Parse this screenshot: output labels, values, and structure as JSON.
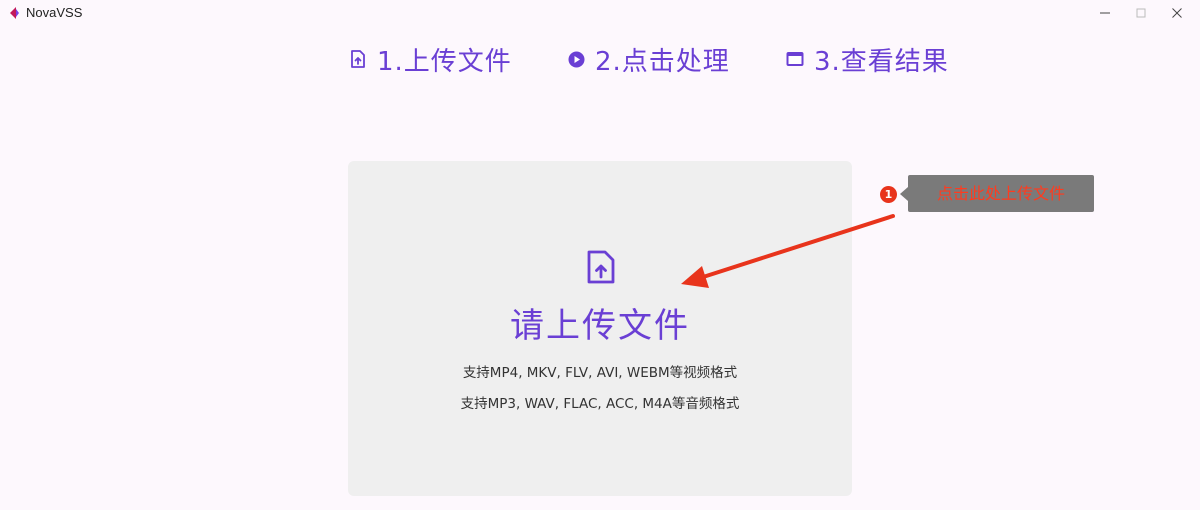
{
  "window": {
    "title": "NovaVSS",
    "controls": {
      "minimize_icon": "minimize-icon",
      "maximize_icon": "maximize-icon",
      "close_icon": "close-icon"
    }
  },
  "nav": {
    "logo_icon": "waveform-logo",
    "steps": [
      {
        "label": "1.上传文件",
        "icon": "file-upload-icon"
      },
      {
        "label": "2.点击处理",
        "icon": "play-circle-icon"
      },
      {
        "label": "3.查看结果",
        "icon": "window-icon"
      }
    ]
  },
  "upload": {
    "icon": "file-upload-icon",
    "title": "请上传文件",
    "hints": [
      "支持MP4, MKV, FLV, AVI, WEBM等视频格式",
      "支持MP3, WAV, FLAC, ACC, M4A等音频格式"
    ]
  },
  "annotation": {
    "badge": "1",
    "text": "点击此处上传文件"
  },
  "colors": {
    "accent": "#6a3fd4",
    "background": "#fdf8fd",
    "dropzone": "#efefef",
    "annotation_red": "#e8341c",
    "tooltip_bg": "#7a7a7a"
  }
}
